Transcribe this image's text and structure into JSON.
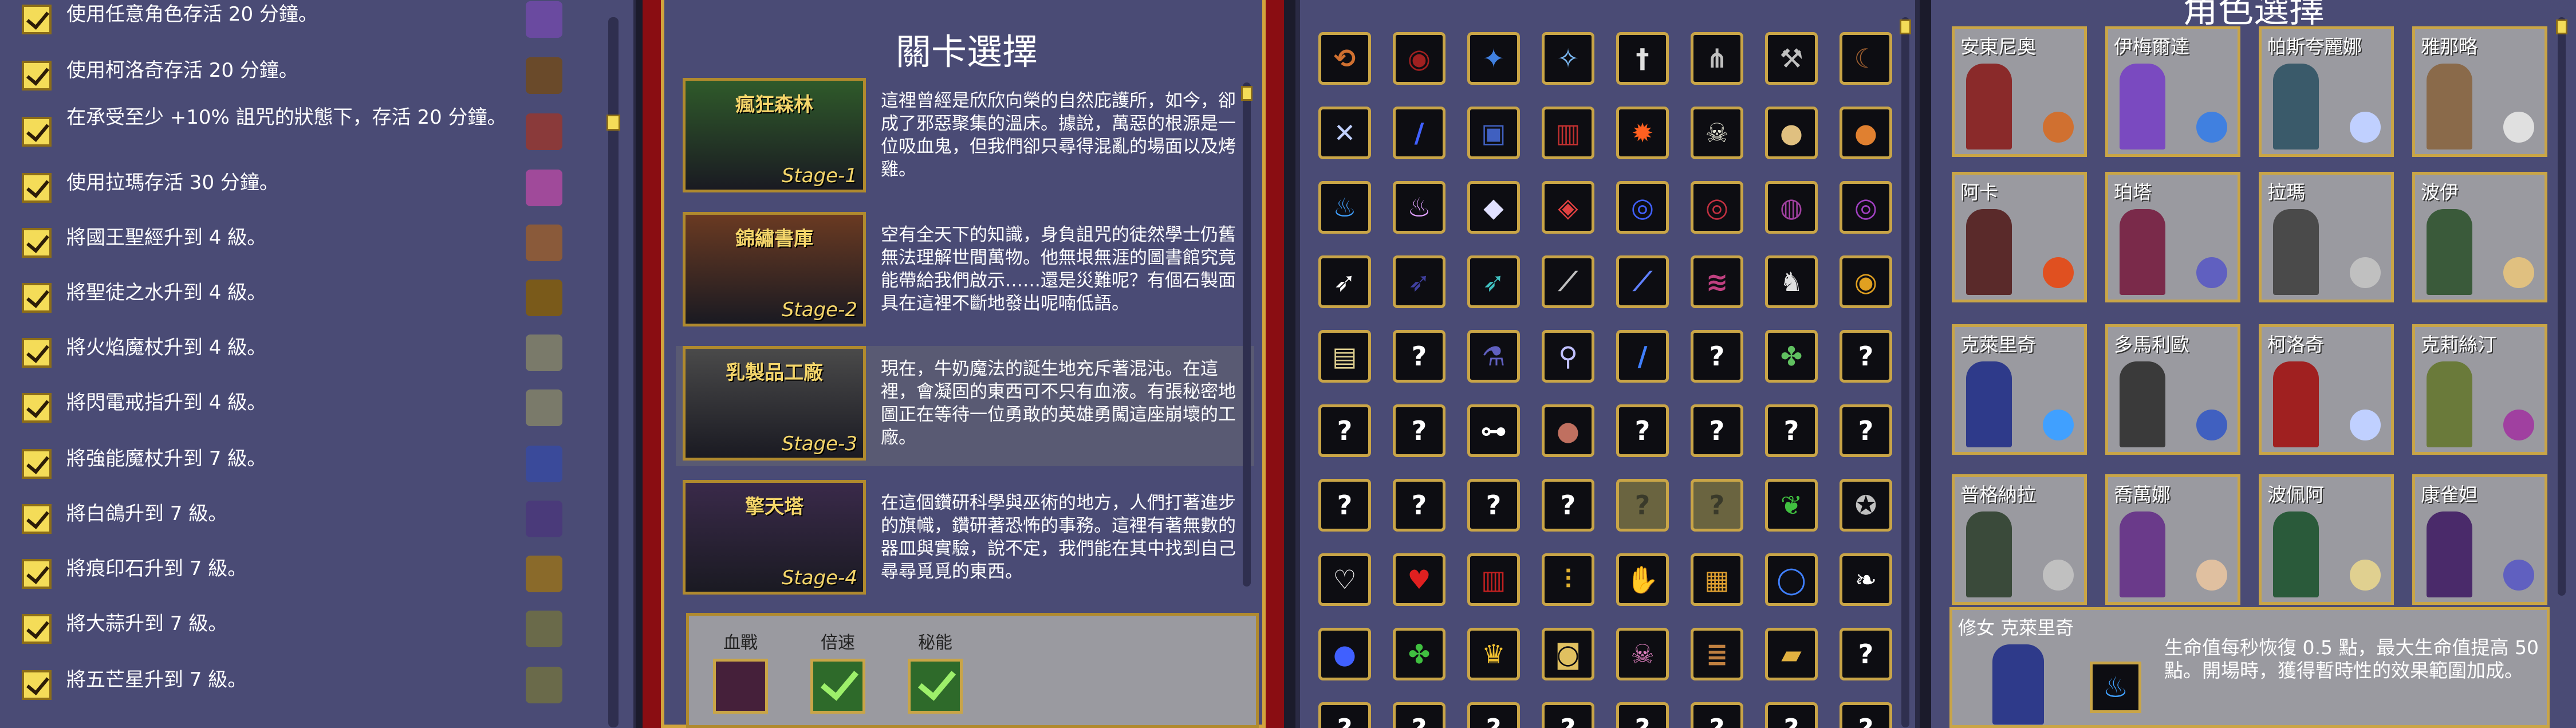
{
  "achievements": [
    {
      "text": "使用任意角色存活 20 分鐘。",
      "icon": "purple-emblem-icon",
      "color": "#6a4aa0"
    },
    {
      "text": "使用柯洛奇存活 20 分鐘。",
      "icon": "stacked-books-icon",
      "color": "#6a4a2a"
    },
    {
      "text": "在承受至少 +10% 詛咒的狀態下，存活 20 分鐘。",
      "icon": "mushroom-icon",
      "color": "#8a3a3a"
    },
    {
      "text": "使用拉瑪存活 30 分鐘。",
      "icon": "pink-skull-icon",
      "color": "#a04a9a"
    },
    {
      "text": "將國王聖經升到 4 級。",
      "icon": "scroll-arm-icon",
      "color": "#8a5a3a"
    },
    {
      "text": "將聖徒之水升到 4 級。",
      "icon": "trident-icon",
      "color": "#7a5a1a"
    },
    {
      "text": "將火焰魔杖升到 4 級。",
      "icon": "old-man-icon",
      "color": "#7a7a6a"
    },
    {
      "text": "將閃電戒指升到 4 級。",
      "icon": "old-man-icon",
      "color": "#7a7a6a"
    },
    {
      "text": "將強能魔杖升到 7 級。",
      "icon": "blue-ring-icon",
      "color": "#3a4a9a"
    },
    {
      "text": "將白鴿升到 7 級。",
      "icon": "dark-bird-icon",
      "color": "#4a3a7a"
    },
    {
      "text": "將痕印石升到 7 級。",
      "icon": "grid-seal-icon",
      "color": "#8a6a2a"
    },
    {
      "text": "將大蒜升到 7 級。",
      "icon": "elder-icon",
      "color": "#6a6a4a"
    },
    {
      "text": "將五芒星升到 7 級。",
      "icon": "elder-icon",
      "color": "#6a6a4a"
    }
  ],
  "stage_panel": {
    "title": "關卡選擇",
    "stages": [
      {
        "name": "瘋狂森林",
        "num": "Stage-1",
        "desc": "這裡曾經是欣欣向榮的自然庇護所，如今，卻成了邪惡聚集的溫床。據說，萬惡的根源是一位吸血鬼，但我們卻只尋得混亂的場面以及烤雞。",
        "bg": "#2f5a2a"
      },
      {
        "name": "錦繡書庫",
        "num": "Stage-2",
        "desc": "空有全天下的知識，身負詛咒的徒然學士仍舊無法理解世間萬物。他無垠無涯的圖書館究竟能帶給我們啟示……還是災難呢？有個石製面具在這裡不斷地發出呢喃低語。",
        "bg": "#6a3a22"
      },
      {
        "name": "乳製品工廠",
        "num": "Stage-3",
        "desc": "現在，牛奶魔法的誕生地充斥著混沌。在這裡，會凝固的東西可不只有血液。有張秘密地圖正在等待一位勇敢的英雄勇闖這座崩壞的工廠。",
        "bg": "#4a4a4a"
      },
      {
        "name": "擎天塔",
        "num": "Stage-4",
        "desc": "在這個鑽研科學與巫術的地方，人們打著進步的旗幟，鑽研著恐怖的事務。這裡有著無數的器皿與實驗，說不定，我們能在其中找到自己尋尋覓覓的東西。",
        "bg": "#3a2a4a"
      }
    ],
    "options": [
      {
        "label": "血戰",
        "checked": false
      },
      {
        "label": "倍速",
        "checked": true
      },
      {
        "label": "秘能",
        "checked": true
      }
    ]
  },
  "collection": {
    "rows": [
      [
        {
          "g": "⟲",
          "c": "#d07030"
        },
        {
          "g": "◉",
          "c": "#a02020"
        },
        {
          "g": "✦",
          "c": "#4080e0"
        },
        {
          "g": "✧",
          "c": "#80c0ff"
        },
        {
          "g": "†",
          "c": "#e0e0e0"
        },
        {
          "g": "⋔",
          "c": "#c0c0c0"
        },
        {
          "g": "⚒",
          "c": "#c0c0c0"
        },
        {
          "g": "☾",
          "c": "#a06030"
        }
      ],
      [
        {
          "g": "✕",
          "c": "#c0d0ff"
        },
        {
          "g": "/",
          "c": "#4060ff"
        },
        {
          "g": "▣",
          "c": "#4060c0"
        },
        {
          "g": "▥",
          "c": "#c03030"
        },
        {
          "g": "✹",
          "c": "#ff6020"
        },
        {
          "g": "☠",
          "c": "#e0e0d0"
        },
        {
          "g": "●",
          "c": "#e0c080"
        },
        {
          "g": "●",
          "c": "#e08030"
        }
      ],
      [
        {
          "g": "♨",
          "c": "#40a0ff"
        },
        {
          "g": "♨",
          "c": "#e0a0ff"
        },
        {
          "g": "◆",
          "c": "#e0e0ff"
        },
        {
          "g": "◈",
          "c": "#e04040"
        },
        {
          "g": "◎",
          "c": "#4060ff"
        },
        {
          "g": "◎",
          "c": "#c03040"
        },
        {
          "g": "◍",
          "c": "#a040a0"
        },
        {
          "g": "◎",
          "c": "#a040c0"
        }
      ],
      [
        {
          "g": "➶",
          "c": "#ffffff"
        },
        {
          "g": "➶",
          "c": "#4040a0"
        },
        {
          "g": "➶",
          "c": "#40c0c0"
        },
        {
          "g": "⟋",
          "c": "#c0c0c0"
        },
        {
          "g": "⟋",
          "c": "#6080ff"
        },
        {
          "g": "≋",
          "c": "#c04080"
        },
        {
          "g": "♞",
          "c": "#e0e0e0"
        },
        {
          "g": "◉",
          "c": "#e0a020"
        }
      ],
      [
        {
          "g": "▤",
          "c": "#e0d090"
        },
        {
          "g": "?",
          "c": "#ffffff"
        },
        {
          "g": "⚗",
          "c": "#6060c0"
        },
        {
          "g": "⚲",
          "c": "#c0c0ff"
        },
        {
          "g": "/",
          "c": "#4080ff"
        },
        {
          "g": "?",
          "c": "#ffffff"
        },
        {
          "g": "✤",
          "c": "#60c060"
        },
        {
          "g": "?",
          "c": "#ffffff"
        }
      ],
      [
        {
          "g": "?",
          "c": "#ffffff"
        },
        {
          "g": "?",
          "c": "#ffffff"
        },
        {
          "g": "⊶",
          "c": "#ffffff"
        },
        {
          "g": "●",
          "c": "#c07060"
        },
        {
          "g": "?",
          "c": "#ffffff"
        },
        {
          "g": "?",
          "c": "#ffffff"
        },
        {
          "g": "?",
          "c": "#ffffff"
        },
        {
          "g": "?",
          "c": "#ffffff"
        }
      ],
      [
        {
          "g": "?",
          "c": "#ffffff"
        },
        {
          "g": "?",
          "c": "#ffffff"
        },
        {
          "g": "?",
          "c": "#ffffff"
        },
        {
          "g": "?",
          "c": "#ffffff"
        },
        {
          "g": "?",
          "c": "#3a3a2a",
          "dim": true
        },
        {
          "g": "?",
          "c": "#3a3a2a",
          "dim": true
        },
        {
          "g": "❦",
          "c": "#40c040"
        },
        {
          "g": "✪",
          "c": "#c0c0c0"
        }
      ],
      [
        {
          "g": "♡",
          "c": "#ffffff"
        },
        {
          "g": "♥",
          "c": "#e02020"
        },
        {
          "g": "▥",
          "c": "#c02020"
        },
        {
          "g": "⫶",
          "c": "#e0b030"
        },
        {
          "g": "✋",
          "c": "#a06040"
        },
        {
          "g": "▦",
          "c": "#e0a030"
        },
        {
          "g": "◯",
          "c": "#4080ff"
        },
        {
          "g": "❧",
          "c": "#ffffff"
        }
      ],
      [
        {
          "g": "●",
          "c": "#4060ff"
        },
        {
          "g": "✤",
          "c": "#40c040"
        },
        {
          "g": "♛",
          "c": "#f0c030"
        },
        {
          "g": "◙",
          "c": "#e0c060"
        },
        {
          "g": "☠",
          "c": "#e080c0"
        },
        {
          "g": "≣",
          "c": "#c08040"
        },
        {
          "g": "▰",
          "c": "#e0b040"
        },
        {
          "g": "?",
          "c": "#ffffff"
        }
      ],
      [
        {
          "g": "?",
          "c": "#ffffff"
        },
        {
          "g": "?",
          "c": "#ffffff"
        },
        {
          "g": "?",
          "c": "#ffffff"
        },
        {
          "g": "?",
          "c": "#ffffff"
        },
        {
          "g": "?",
          "c": "#ffffff"
        },
        {
          "g": "?",
          "c": "#ffffff"
        },
        {
          "g": "?",
          "c": "#ffffff"
        },
        {
          "g": "?",
          "c": "#ffffff"
        }
      ]
    ]
  },
  "character_panel": {
    "title": "角色選擇",
    "characters": [
      {
        "name": "安東尼奧",
        "fig": "#8a2a2a",
        "weap": "#d07030"
      },
      {
        "name": "伊梅爾達",
        "fig": "#7a4ac0",
        "weap": "#4080e0"
      },
      {
        "name": "帕斯夸麗娜",
        "fig": "#3a5a6a",
        "weap": "#c0d0ff"
      },
      {
        "name": "雅那略",
        "fig": "#8a6a4a",
        "weap": "#e0e0e0"
      },
      {
        "name": "阿卡",
        "fig": "#5a2a2a",
        "weap": "#e05020"
      },
      {
        "name": "珀塔",
        "fig": "#7a2a4a",
        "weap": "#6060c0"
      },
      {
        "name": "拉瑪",
        "fig": "#4a4a4a",
        "weap": "#c0c0c0"
      },
      {
        "name": "波伊",
        "fig": "#3a5a3a",
        "weap": "#e0c080"
      },
      {
        "name": "克萊里奇",
        "fig": "#2e3a8a",
        "weap": "#40a0ff"
      },
      {
        "name": "多馬利歐",
        "fig": "#3a3a3a",
        "weap": "#4060c0"
      },
      {
        "name": "柯洛奇",
        "fig": "#a02020",
        "weap": "#c0d0ff"
      },
      {
        "name": "克莉絲汀",
        "fig": "#6a7a3a",
        "weap": "#a040a0"
      },
      {
        "name": "普格納拉",
        "fig": "#3a4a3a",
        "weap": "#c0c0c0"
      },
      {
        "name": "喬萬娜",
        "fig": "#6a3a8a",
        "weap": "#e0c0a0"
      },
      {
        "name": "波佩阿",
        "fig": "#2a5a3a",
        "weap": "#e0d090"
      },
      {
        "name": "康雀妲",
        "fig": "#4a2a6a",
        "weap": "#6060c0"
      }
    ],
    "selected": {
      "name": "修女 克萊里奇",
      "desc": "生命值每秒恢復 0.5 點，最大生命值提高 50 點。開場時，獲得暫時性的效果範圍加成。"
    }
  }
}
